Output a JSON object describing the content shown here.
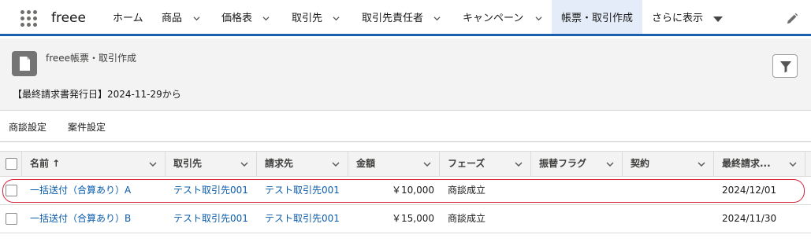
{
  "nav": {
    "app_name": "freee",
    "items": [
      {
        "label": "ホーム"
      },
      {
        "label": "商品"
      },
      {
        "label": "価格表"
      },
      {
        "label": "取引先"
      },
      {
        "label": "取引先責任者"
      },
      {
        "label": "キャンペーン"
      },
      {
        "label": "帳票・取引作成"
      },
      {
        "label": "さらに表示"
      }
    ]
  },
  "header": {
    "title": "freee帳票・取引作成",
    "subtitle": "【最終請求書発行日】2024-11-29から"
  },
  "tabs": [
    {
      "label": "商談設定"
    },
    {
      "label": "案件設定"
    }
  ],
  "table": {
    "columns": [
      {
        "label": "名前 ↑"
      },
      {
        "label": "取引先"
      },
      {
        "label": "請求先"
      },
      {
        "label": "金額"
      },
      {
        "label": "フェーズ"
      },
      {
        "label": "振替フラグ"
      },
      {
        "label": "契約"
      },
      {
        "label": "最終請求..."
      }
    ],
    "rows": [
      {
        "name": "一括送付（合算あり）A",
        "account": "テスト取引先001",
        "billing": "テスト取引先001",
        "amount": "￥10,000",
        "phase": "商談成立",
        "transfer": "",
        "contract": "",
        "last_billing": "2024/12/01",
        "highlighted": true
      },
      {
        "name": "一括送付（合算あり）B",
        "account": "テスト取引先001",
        "billing": "テスト取引先001",
        "amount": "￥15,000",
        "phase": "商談成立",
        "transfer": "",
        "contract": "",
        "last_billing": "2024/11/30",
        "highlighted": false
      }
    ]
  },
  "colors": {
    "accent": "#1b5fb0",
    "link": "#0b5cab",
    "highlight": "#d9203a",
    "active_tab_bg": "#e3ecf8"
  }
}
